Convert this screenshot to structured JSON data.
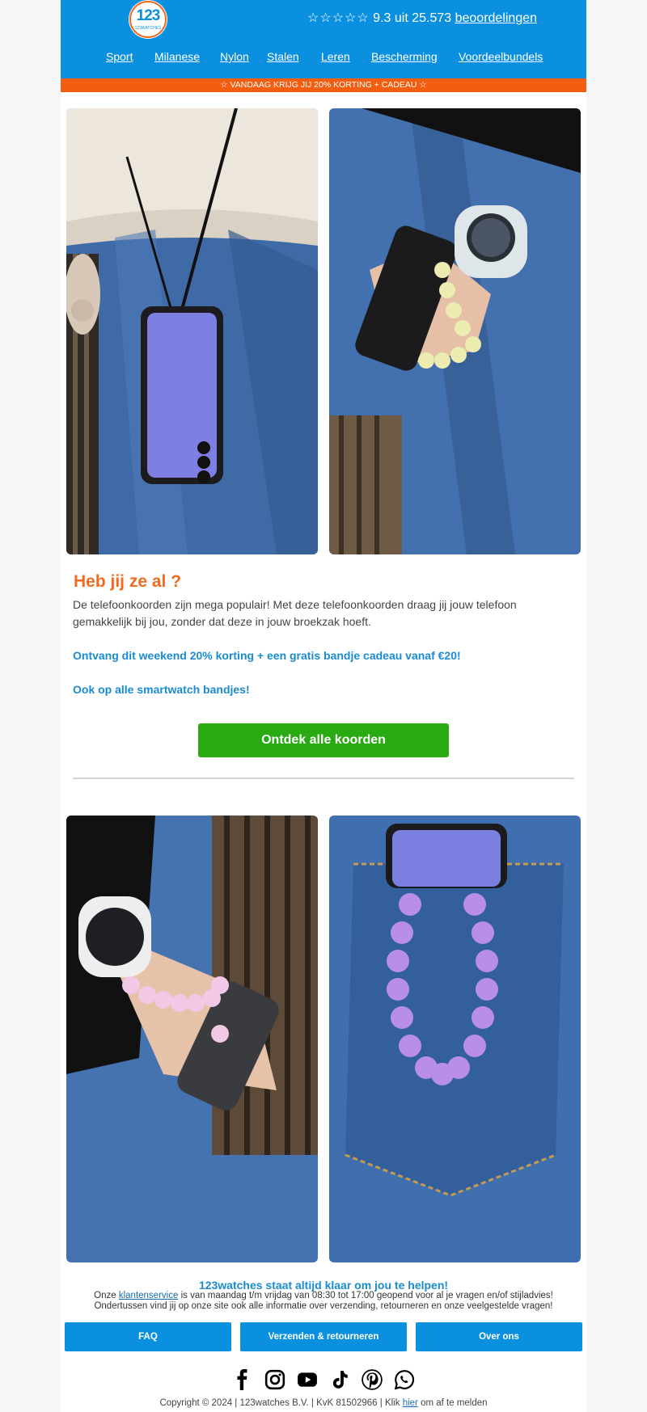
{
  "brand": {
    "logo_text": "123",
    "logo_subtext": "123WATCHES"
  },
  "header": {
    "stars": "☆☆☆☆☆",
    "rating_text": "9.3 uit 25.573",
    "reviews_link": "beoordelingen"
  },
  "nav": [
    "Sport",
    "Milanese",
    "Nylon",
    "Stalen",
    "Leren",
    "Bescherming",
    "Voordeelbundels"
  ],
  "promo_bar": "☆ VANDAAG KRIJG JIJ 20% KORTING + CADEAU ☆",
  "content": {
    "headline": "Heb jij ze al ?",
    "body": "De telefoonkoorden zijn mega populair! Met deze telefoonkoorden draag jij jouw telefoon gemakkelijk bij jou, zonder dat deze in jouw broekzak hoeft.",
    "offer_1": "Ontvang dit weekend 20% korting + een gratis bandje cadeau vanaf €20!",
    "offer_2": "Ook op alle smartwatch bandjes!",
    "cta": "Ontdek alle koorden"
  },
  "help": {
    "title": "123watches staat altijd klaar om jou te helpen!",
    "line1_prefix": "Onze",
    "line1_link": "klantenservice",
    "line1_suffix": "is van maandag t/m vrijdag van 08:30 tot 17:00 geopend voor al je vragen en/of stijladvies!",
    "line2": "Ondertussen vind jij op onze site ook alle informatie over verzending, retourneren en onze veelgestelde vragen!"
  },
  "footer_buttons": [
    "FAQ",
    "Verzenden & retourneren",
    "Over ons"
  ],
  "social_icons": [
    "facebook-icon",
    "instagram-icon",
    "youtube-icon",
    "tiktok-icon",
    "pinterest-icon",
    "whatsapp-icon"
  ],
  "copyright": {
    "text": "Copyright © 2024 | 123watches B.V. | KvK 81502966 | Klik",
    "link": "hier",
    "suffix": "om af te melden"
  },
  "colors": {
    "brand_blue": "#0b90e0",
    "promo_orange": "#f25d0f",
    "headline_orange": "#f06a1f",
    "cta_green": "#2aaa12",
    "offer_blue": "#1a8bd0"
  }
}
